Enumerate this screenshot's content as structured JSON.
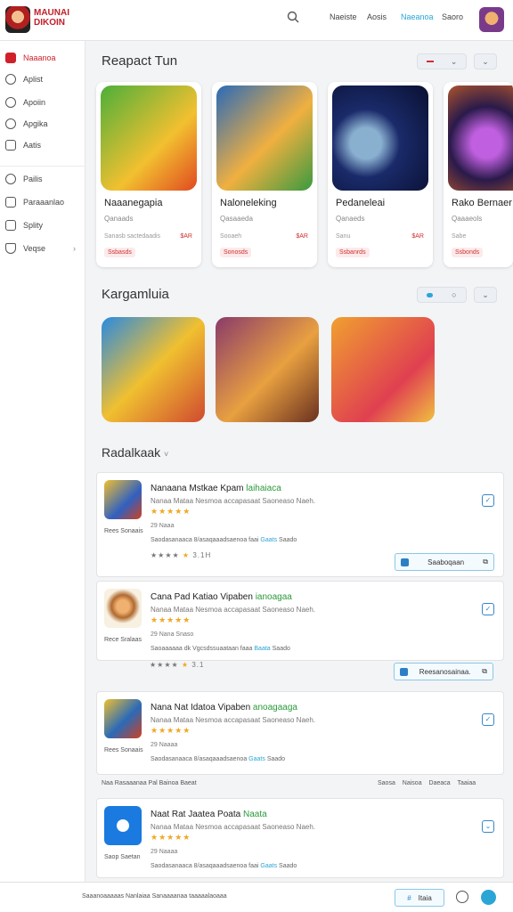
{
  "brand": {
    "line1": "MAUNAI",
    "line2": "DIKOIN"
  },
  "nav": {
    "links": [
      "Naeiste",
      "Aosis",
      "Naeanoa",
      "Saoro"
    ],
    "active_index": 2
  },
  "sidebar": {
    "items": [
      {
        "label": "Naaanoa",
        "icon": "home-icon",
        "active": true
      },
      {
        "label": "Aplist",
        "icon": "plus-icon"
      },
      {
        "label": "Apoiin",
        "icon": "circle-icon"
      },
      {
        "label": "Apgika",
        "icon": "clock-icon"
      },
      {
        "label": "Aatis",
        "icon": "square-icon"
      },
      {
        "label": "Pailis",
        "icon": "gear-icon"
      },
      {
        "label": "Paraaanlao",
        "icon": "calendar-icon"
      },
      {
        "label": "Splity",
        "icon": "book-icon"
      },
      {
        "label": "Veqse",
        "icon": "shield-icon"
      }
    ]
  },
  "section1": {
    "title": "Reapact Tun",
    "cards": [
      {
        "name": "Naaanegapia",
        "sub": "Qanaads",
        "meta": "Sanasb sactedaadis",
        "price": "$AR",
        "tag": "Ssbasds",
        "colors": [
          "#4caf3a",
          "#f2c030"
        ]
      },
      {
        "name": "Naloneleking",
        "sub": "Qasaaeda",
        "meta": "Sooaeh",
        "price": "$AR",
        "tag": "Sonosds",
        "colors": [
          "#2a6ab8",
          "#f0b040"
        ]
      },
      {
        "name": "Pedaneleai",
        "sub": "Qanaeds",
        "meta": "Sanu",
        "price": "$AR",
        "tag": "Ssbanrds",
        "colors": [
          "#1a2a6a",
          "#e84aa0"
        ]
      },
      {
        "name": "Rako Bernaer",
        "sub": "Qaaaeols",
        "meta": "Sabe",
        "price": "",
        "tag": "Ssbonds",
        "colors": [
          "#2a1a4a",
          "#e06a20"
        ]
      }
    ]
  },
  "section2": {
    "title": "Kargamluia",
    "tiles": [
      {
        "colors": [
          "#2a8ae0",
          "#f0c030"
        ]
      },
      {
        "colors": [
          "#8a3a6a",
          "#e8a040"
        ]
      },
      {
        "colors": [
          "#f0a030",
          "#e04050"
        ]
      }
    ]
  },
  "section3": {
    "title": "Radalkaak",
    "items": [
      {
        "title": "Nanaana Mstkae Kpam",
        "title_accent": "laihaiaca",
        "desc": "Nanaa Mataa Nesmoa accapasaat Saoneaso Naeh.",
        "stars": "★★★★★",
        "price": "29 Naaa",
        "detail": "Saodasanaaca 8/asaqaaadsaenoa faai",
        "detail_link": "Gaats",
        "detail_end": "Saado",
        "rating": "3.1H",
        "button": "Saaboqaan",
        "publisher": "Rees Sonaais",
        "colors": [
          "#f0c030",
          "#3060c0"
        ]
      },
      {
        "title": "Cana Pad Katiao Vipaben",
        "title_accent": "ianoagaa",
        "desc": "Nanaa Mataa Nesmoa accapasaat Saoneaso Naeh.",
        "stars": "★★★★★",
        "price": "29 Nana Snaso",
        "detail": "Saoaaaaaa dk Vgcsdssuaataan faaa",
        "detail_link": "Baata",
        "detail_end": "Saado",
        "rating": "3.1",
        "button": "Reesanosainaa.",
        "publisher": "Rece Sralaas",
        "colors": [
          "#f8f0e0",
          "#b06a30"
        ]
      },
      {
        "title": "Nana Nat Idatoa Vipaben",
        "title_accent": "anoagaaga",
        "desc": "Nanaa Mataa Nesmoa accapasaat Saoneaso Naeh.",
        "stars": "★★★★★",
        "price": "29 Naaaa",
        "detail": "Saodasanaaca 8/asaqaaadsaenoa",
        "detail_link": "Gaats",
        "detail_end": "Saado",
        "rating": "",
        "button": "",
        "publisher": "Rees Sonaais",
        "colors": [
          "#f0c030",
          "#2a6ab8"
        ]
      },
      {
        "title": "Naat Rat Jaatea Poata",
        "title_accent": "Naata",
        "desc": "Nanaa Mataa Nesmoa accapasaat Saoneaso Naeh.",
        "stars": "★★★★★",
        "price": "29 Naaaa",
        "detail": "Saodasanaaca 8/asaqaaadsaenoa faai",
        "detail_link": "Gaats",
        "detail_end": "Saado",
        "rating": "",
        "button": "",
        "publisher": "Saop Saetan",
        "colors": [
          "#1a7ae0",
          "#ffffff"
        ]
      }
    ],
    "footer_text": "Naa Rasaaanaa Pal Bainoa Baeat",
    "footer_links": "Saosa Naisoa Daeaca Taaiaa"
  },
  "bottom": {
    "text": "Saaanoaaaaas Nanlaiaa Sanaaaanaa taaaaalaoaaa",
    "button": "Itaia"
  }
}
